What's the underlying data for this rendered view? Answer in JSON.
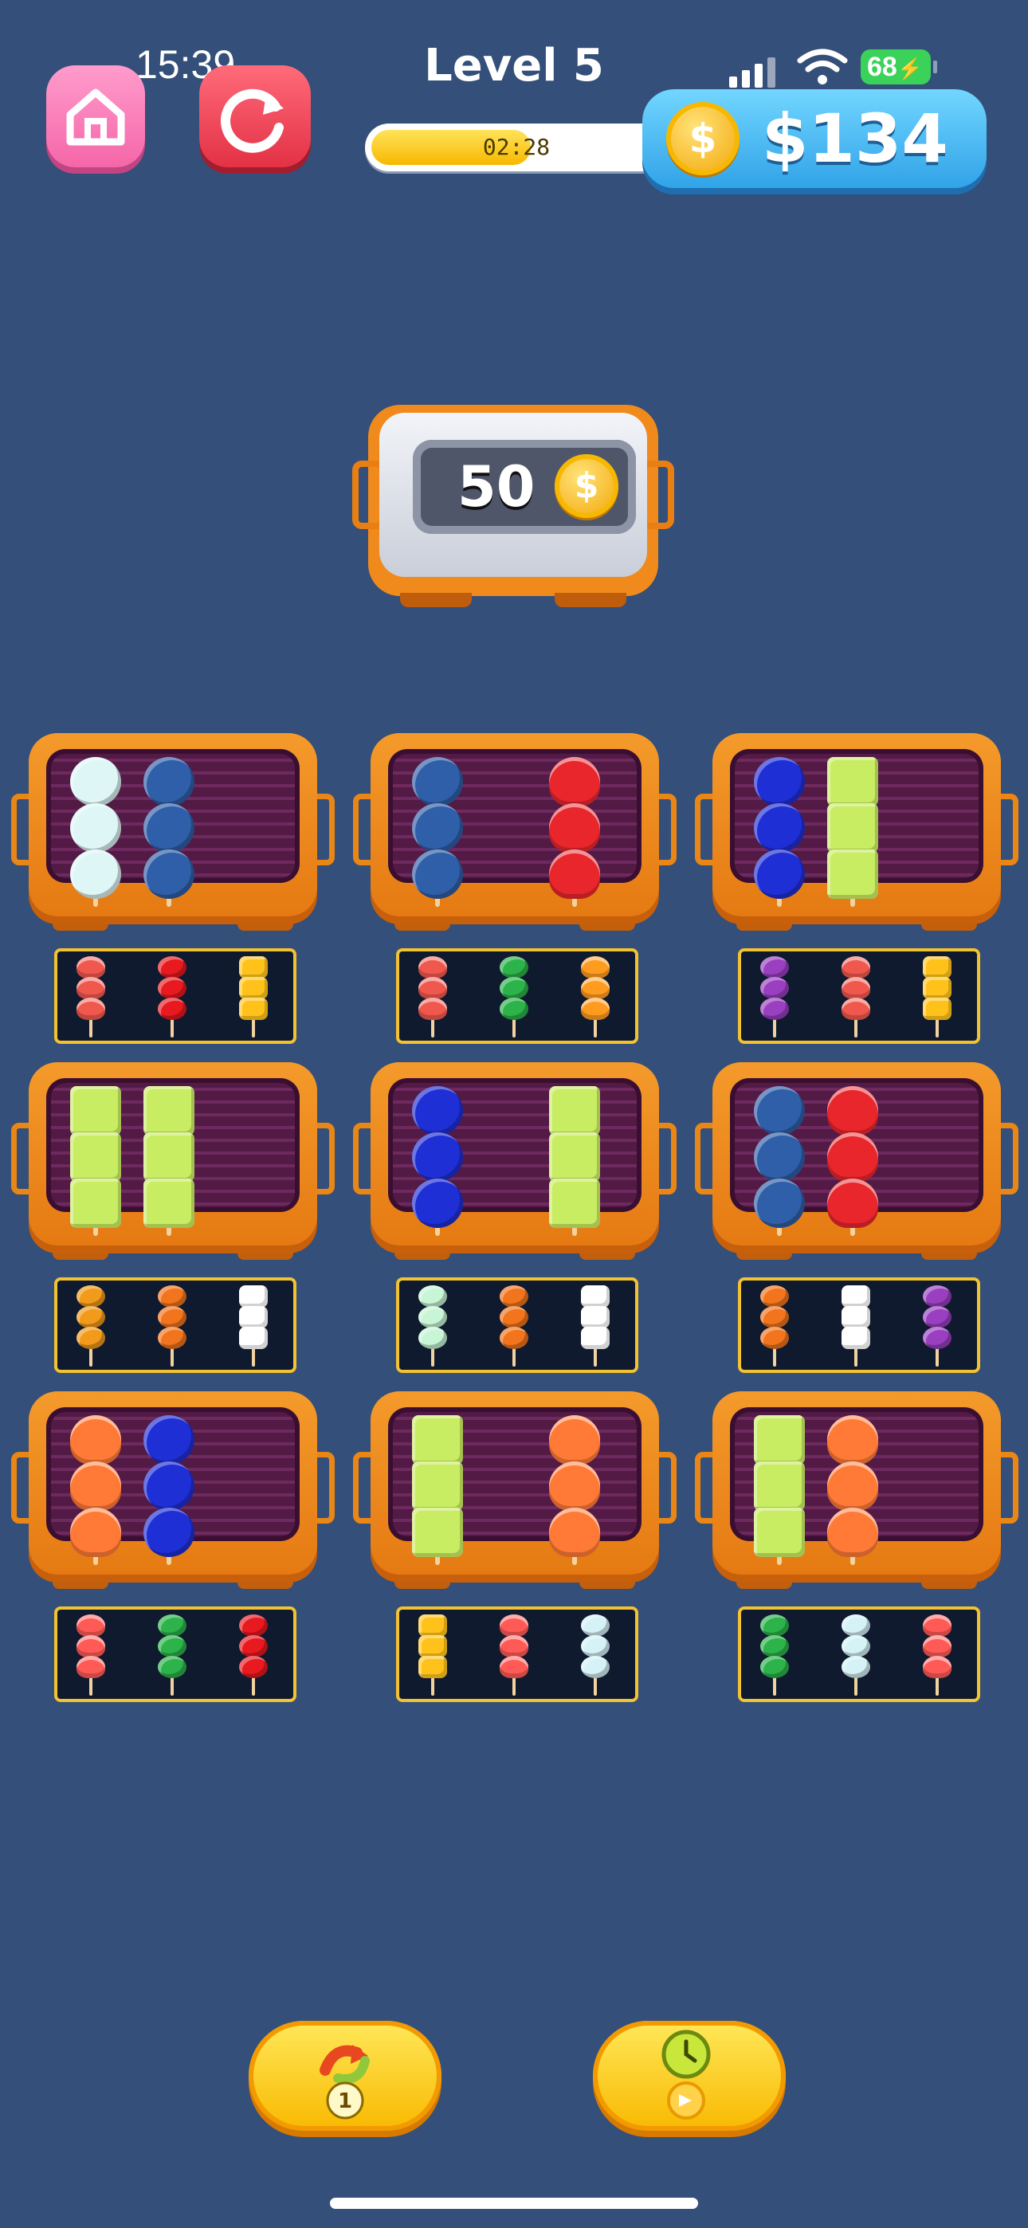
{
  "status_bar": {
    "time": "15:39",
    "battery": "68"
  },
  "header": {
    "level_title": "Level 5",
    "timer": "02:28",
    "timer_progress": 0.55,
    "money": "$134"
  },
  "prize": {
    "amount": "50"
  },
  "colors": {
    "background": "#344f79",
    "marshmallow": "#dff6f7",
    "blueberry": "#2f5fa8",
    "strawberry": "#e8262b",
    "blue_candy": "#1f2fd6",
    "lime_cube": "#c8ec62",
    "orange_slice": "#ff7a36",
    "watermelon": "#f0584e",
    "tomato": "#e8191f",
    "pineapple": "#ffc21a",
    "grape": "#9a3fc0",
    "green_ball": "#2cb34a",
    "orange_wedge": "#ff9b1e",
    "honey": "#f29a1a",
    "orange_ball": "#f2741c",
    "white_cube": "#ffffff",
    "mint": "#c8f5d6",
    "grapefruit": "#ff5a56",
    "ice": "#d5f2f7"
  },
  "grills": [
    {
      "skewers": [
        "marshmallow",
        "blueberry"
      ],
      "tray": [
        "watermelon",
        "tomato",
        "pineapple"
      ]
    },
    {
      "skewers": [
        "blueberry",
        "strawberry"
      ],
      "tray": [
        "watermelon",
        "green_ball",
        "orange_wedge"
      ]
    },
    {
      "skewers": [
        "blue_candy",
        "lime_cube"
      ],
      "tray": [
        "grape",
        "watermelon",
        "pineapple"
      ]
    },
    {
      "skewers": [
        "lime_cube",
        "lime_cube"
      ],
      "tray": [
        "honey",
        "orange_ball",
        "white_cube"
      ]
    },
    {
      "skewers": [
        "blue_candy",
        "lime_cube"
      ],
      "tray": [
        "mint",
        "orange_ball",
        "white_cube"
      ]
    },
    {
      "skewers": [
        "blueberry",
        "strawberry"
      ],
      "tray": [
        "orange_ball",
        "white_cube",
        "grape"
      ]
    },
    {
      "skewers": [
        "orange_slice",
        "blue_candy"
      ],
      "tray": [
        "grapefruit",
        "green_ball",
        "tomato"
      ]
    },
    {
      "skewers": [
        "lime_cube",
        "orange_slice"
      ],
      "tray": [
        "pineapple",
        "grapefruit",
        "ice"
      ]
    },
    {
      "skewers": [
        "lime_cube",
        "orange_slice"
      ],
      "tray": [
        "green_ball",
        "ice",
        "grapefruit"
      ]
    }
  ],
  "boosters": [
    {
      "name": "shuffle",
      "count": "1"
    },
    {
      "name": "add-time",
      "count": ""
    }
  ]
}
